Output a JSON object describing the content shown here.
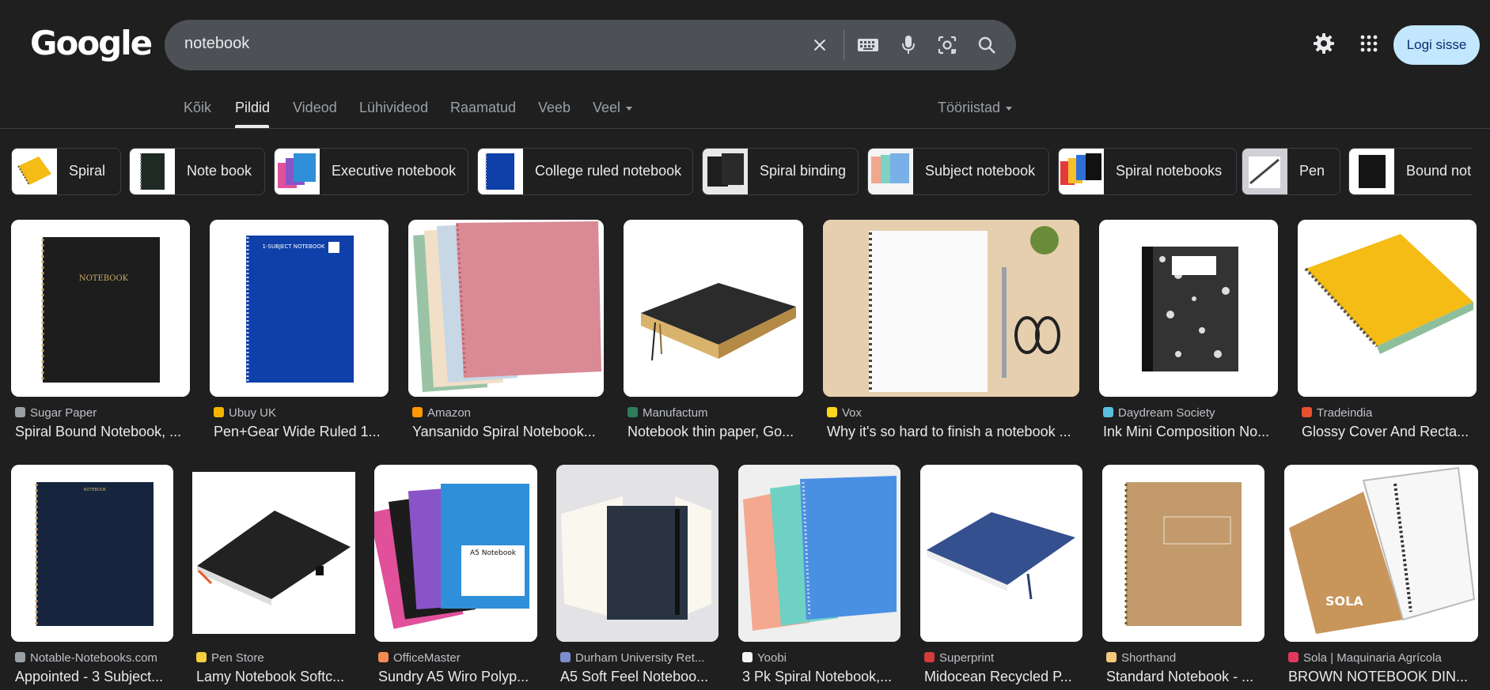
{
  "header": {
    "logo": "Google",
    "search_value": "notebook",
    "login_label": "Logi sisse"
  },
  "icons": {
    "clear": "close-icon",
    "keyboard": "keyboard-icon",
    "voice": "microphone-icon",
    "lens": "camera-icon",
    "search": "search-icon",
    "settings": "gear-icon",
    "apps": "apps-grid-icon"
  },
  "tabs": [
    {
      "label": "Kõik"
    },
    {
      "label": "Pildid"
    },
    {
      "label": "Videod"
    },
    {
      "label": "Lühivideod"
    },
    {
      "label": "Raamatud"
    },
    {
      "label": "Veeb"
    },
    {
      "label": "Veel"
    }
  ],
  "tools_label": "Tööriistad",
  "chips": [
    {
      "label": "Spiral"
    },
    {
      "label": "Note book"
    },
    {
      "label": "Executive notebook"
    },
    {
      "label": "College ruled notebook"
    },
    {
      "label": "Spiral binding"
    },
    {
      "label": "Subject notebook"
    },
    {
      "label": "Spiral notebooks"
    },
    {
      "label": "Pen"
    },
    {
      "label": "Bound note"
    }
  ],
  "results": [
    {
      "source": "Sugar Paper",
      "title": "Spiral Bound Notebook, ...",
      "fav_color": "#9aa0a6",
      "book_color": "#1d1d1d",
      "bg": "#ffffff",
      "cover_text": "NOTEBOOK"
    },
    {
      "source": "Ubuy UK",
      "title": "Pen+Gear Wide Ruled 1...",
      "fav_color": "#f4b400",
      "book_color": "#0f3fa8",
      "bg": "#ffffff",
      "cover_text": "1-SUBJECT NOTEBOOK"
    },
    {
      "source": "Amazon",
      "title": "Yansanido Spiral Notebook...",
      "fav_color": "#ff9900",
      "book_color": "#d98a94",
      "bg": "#ffffff",
      "cover_text": ""
    },
    {
      "source": "Manufactum",
      "title": "Notebook thin paper, Go...",
      "fav_color": "#2e7d5b",
      "book_color": "#2b2b2b",
      "bg": "#ffffff",
      "cover_text": ""
    },
    {
      "source": "Vox",
      "title": "Why it's so hard to finish a notebook ...",
      "fav_color": "#f9d71c",
      "book_color": "#fafafa",
      "bg": "#e6cfae",
      "cover_text": ""
    },
    {
      "source": "Daydream Society",
      "title": "Ink Mini Composition No...",
      "fav_color": "#5bc0de",
      "book_color": "#333333",
      "bg": "#ffffff",
      "cover_text": ""
    },
    {
      "source": "Tradeindia",
      "title": "Glossy Cover And Recta...",
      "fav_color": "#e8502f",
      "book_color": "#f5bc16",
      "bg": "#ffffff",
      "cover_text": ""
    },
    {
      "source": "Notable-Notebooks.com",
      "title": "Appointed - 3 Subject...",
      "fav_color": "#9aa0a6",
      "book_color": "#16253d",
      "bg": "#ffffff",
      "cover_text": "NOTEBOOK"
    },
    {
      "source": "Pen Store",
      "title": "Lamy Notebook Softc...",
      "fav_color": "#f4d03f",
      "book_color": "#222222",
      "bg": "#ffffff",
      "cover_text": ""
    },
    {
      "source": "OfficeMaster",
      "title": "Sundry A5 Wiro Polyp...",
      "fav_color": "#f28b54",
      "book_color": "#2f8fd8",
      "bg": "#ffffff",
      "cover_text": "A5 Notebook"
    },
    {
      "source": "Durham University Ret...",
      "title": "A5 Soft Feel Noteboo...",
      "fav_color": "#7b8ccf",
      "book_color": "#2a3342",
      "bg": "#e3e3e6",
      "cover_text": ""
    },
    {
      "source": "Yoobi",
      "title": "3 Pk Spiral Notebook,...",
      "fav_color": "#f5f5f5",
      "book_color": "#4a90e2",
      "bg": "#efefef",
      "cover_text": ""
    },
    {
      "source": "Superprint",
      "title": "Midocean Recycled P...",
      "fav_color": "#d43b3b",
      "book_color": "#34508e",
      "bg": "#ffffff",
      "cover_text": ""
    },
    {
      "source": "Shorthand",
      "title": "Standard Notebook - ...",
      "fav_color": "#f5c77e",
      "book_color": "#c29a6b",
      "bg": "#ffffff",
      "cover_text": ""
    },
    {
      "source": "Sola | Maquinaria Agrícola",
      "title": "BROWN NOTEBOOK DIN...",
      "fav_color": "#e03a5b",
      "book_color": "#c8955a",
      "bg": "#ffffff",
      "cover_text": "SOLA"
    }
  ]
}
